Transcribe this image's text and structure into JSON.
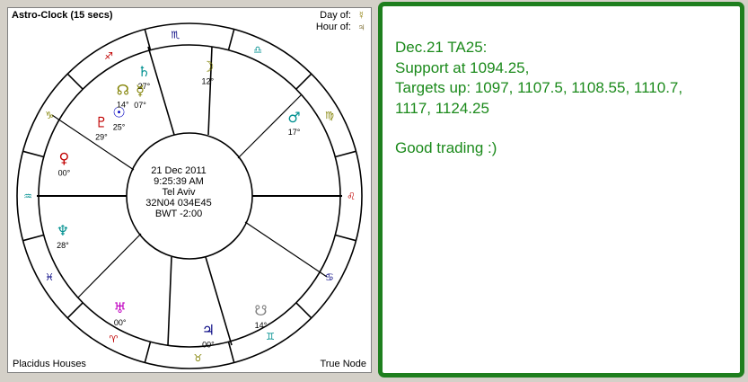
{
  "clock": {
    "title": "Astro-Clock (15 secs)",
    "day_of_label": "Day of:",
    "hour_of_label": "Hour of:",
    "day_ruler_glyph": "☿",
    "hour_ruler_glyph": "♃",
    "house_system": "Placidus Houses",
    "node_type": "True Node",
    "center": {
      "date": "21 Dec 2011",
      "time": "9:25:39 AM",
      "place": "Tel Aviv",
      "coords": "32N04 034E45",
      "zone": "BWT -2:00"
    },
    "zodiac_glyphs": [
      {
        "name": "scorpio",
        "glyph": "♏",
        "color": "#000080"
      },
      {
        "name": "libra",
        "glyph": "♎",
        "color": "#009090"
      },
      {
        "name": "virgo",
        "glyph": "♍",
        "color": "#808000"
      },
      {
        "name": "leo",
        "glyph": "♌",
        "color": "#c00000"
      },
      {
        "name": "cancer",
        "glyph": "♋",
        "color": "#000080"
      },
      {
        "name": "gemini",
        "glyph": "♊",
        "color": "#009090"
      },
      {
        "name": "taurus",
        "glyph": "♉",
        "color": "#808000"
      },
      {
        "name": "aries",
        "glyph": "♈",
        "color": "#c00000"
      },
      {
        "name": "pisces",
        "glyph": "♓",
        "color": "#000080"
      },
      {
        "name": "aquarius",
        "glyph": "♒",
        "color": "#009090"
      },
      {
        "name": "capricorn",
        "glyph": "♑",
        "color": "#808000"
      },
      {
        "name": "sagittarius",
        "glyph": "♐",
        "color": "#c00000"
      }
    ],
    "planets": [
      {
        "name": "moon",
        "glyph": "☽",
        "deg": "12°",
        "color": "#808000"
      },
      {
        "name": "jupiter",
        "glyph": "♃",
        "deg": "00°",
        "color": "#000080"
      },
      {
        "name": "mars",
        "glyph": "♂",
        "deg": "17°",
        "color": "#009090"
      },
      {
        "name": "venus",
        "glyph": "♀",
        "deg": "00°",
        "color": "#c00000"
      },
      {
        "name": "neptune",
        "glyph": "♆",
        "deg": "28°",
        "color": "#009090"
      },
      {
        "name": "uranus",
        "glyph": "♅",
        "deg": "00°",
        "color": "#c000c0"
      },
      {
        "name": "sun",
        "glyph": "☉",
        "deg": "25°",
        "color": "#0000c0"
      },
      {
        "name": "pluto",
        "glyph": "♇",
        "deg": "29°",
        "color": "#c00000"
      },
      {
        "name": "saturn",
        "glyph": "♄",
        "deg": "27°",
        "color": "#009090"
      },
      {
        "name": "mercury",
        "glyph": "☿",
        "deg": "07°",
        "color": "#808000"
      },
      {
        "name": "node",
        "glyph": "☊",
        "deg": "14°",
        "color": "#808000"
      },
      {
        "name": "south-node",
        "glyph": "☋",
        "deg": "14°",
        "color": "#808080"
      }
    ],
    "cusp_labels": [
      "38",
      "32",
      "05",
      "40",
      "37",
      "42",
      "24",
      "15",
      "04",
      "56",
      "15",
      "27",
      "06°"
    ]
  },
  "message": {
    "line1": "Dec.21 TA25:",
    "line2": "Support at 1094.25,",
    "line3": "Targets up: 1097, 1107.5, 1108.55, 1110.7,",
    "line4": "1117, 1124.25",
    "line5": "Good trading :)"
  },
  "colors": {
    "message_text": "#1b8a1b",
    "message_border": "#1e7f1e"
  }
}
